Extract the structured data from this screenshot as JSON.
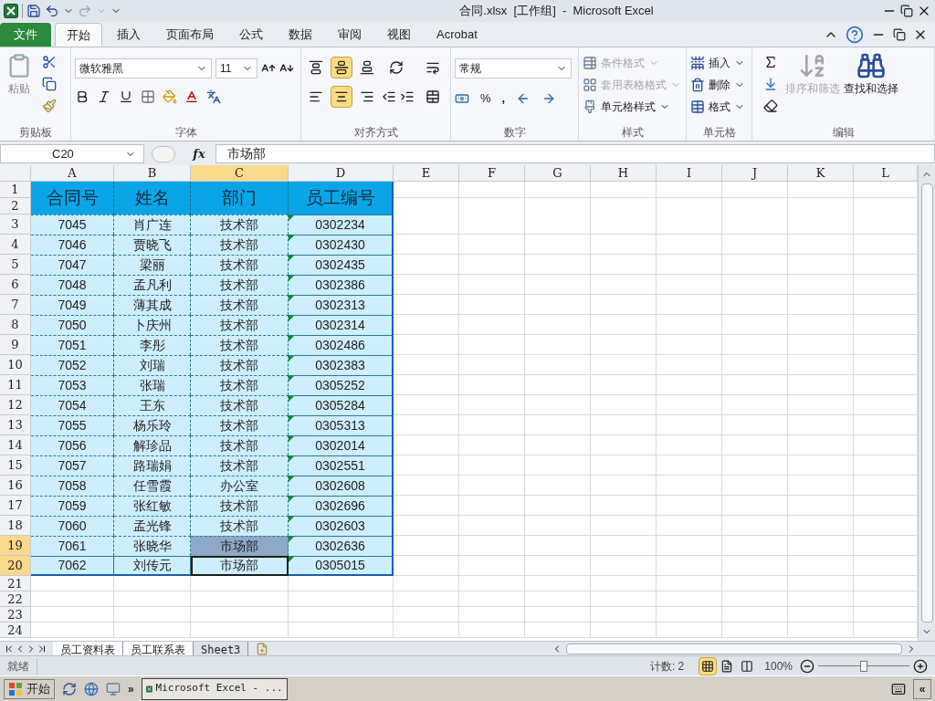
{
  "window": {
    "title": "合同.xlsx  [工作组]  -  Microsoft Excel"
  },
  "menu_tabs": [
    {
      "label": "文件",
      "kind": "file",
      "selected": false
    },
    {
      "label": "开始",
      "kind": "tab",
      "selected": true
    },
    {
      "label": "插入",
      "kind": "tab",
      "selected": false
    },
    {
      "label": "页面布局",
      "kind": "tab",
      "selected": false
    },
    {
      "label": "公式",
      "kind": "tab",
      "selected": false
    },
    {
      "label": "数据",
      "kind": "tab",
      "selected": false
    },
    {
      "label": "审阅",
      "kind": "tab",
      "selected": false
    },
    {
      "label": "视图",
      "kind": "tab",
      "selected": false
    },
    {
      "label": "Acrobat",
      "kind": "tab",
      "selected": false
    }
  ],
  "ribbon": {
    "clipboard": {
      "paste": "粘贴",
      "label": "剪贴板"
    },
    "font": {
      "font_name": "微软雅黑",
      "font_size": "11",
      "label": "字体"
    },
    "alignment": {
      "label": "对齐方式",
      "top_selected": false,
      "middle_selected": true,
      "bottom_selected": false,
      "left_selected": false,
      "center_selected": true,
      "right_selected": false
    },
    "number": {
      "format": "常规",
      "percent": "%",
      "comma": ",",
      "label": "数字"
    },
    "styles": {
      "items": [
        {
          "label": "条件格式",
          "disabled": true
        },
        {
          "label": "套用表格格式",
          "disabled": true
        },
        {
          "label": "单元格样式",
          "disabled": false
        }
      ],
      "label": "样式"
    },
    "cells": {
      "items": [
        {
          "label": "插入"
        },
        {
          "label": "删除"
        },
        {
          "label": "格式"
        }
      ],
      "label": "单元格"
    },
    "editing": {
      "sort": {
        "label": "排序和筛选",
        "disabled": true
      },
      "find": {
        "label": "查找和选择",
        "disabled": false
      },
      "label": "编辑"
    }
  },
  "formula_bar": {
    "name_box": "C20",
    "function_label": "fx",
    "value": "市场部"
  },
  "sheet": {
    "columns": [
      {
        "label": "A",
        "selected": false
      },
      {
        "label": "B",
        "selected": false
      },
      {
        "label": "C",
        "selected": true
      },
      {
        "label": "D",
        "selected": false
      },
      {
        "label": "E",
        "selected": false
      },
      {
        "label": "F",
        "selected": false
      },
      {
        "label": "G",
        "selected": false
      },
      {
        "label": "H",
        "selected": false
      },
      {
        "label": "I",
        "selected": false
      },
      {
        "label": "J",
        "selected": false
      },
      {
        "label": "K",
        "selected": false
      },
      {
        "label": "L",
        "selected": false
      }
    ],
    "header": {
      "row_numbers": [
        "1",
        "2"
      ],
      "cells": [
        "合同号",
        "姓名",
        "部门",
        "员工编号"
      ]
    },
    "rows": [
      {
        "number": "3",
        "selected": false,
        "active": false,
        "cells": [
          "7045",
          "肖广连",
          "技术部",
          "0302234"
        ]
      },
      {
        "number": "4",
        "selected": false,
        "active": false,
        "cells": [
          "7046",
          "贾晓飞",
          "技术部",
          "0302430"
        ]
      },
      {
        "number": "5",
        "selected": false,
        "active": false,
        "cells": [
          "7047",
          "梁丽",
          "技术部",
          "0302435"
        ]
      },
      {
        "number": "6",
        "selected": false,
        "active": false,
        "cells": [
          "7048",
          "孟凡利",
          "技术部",
          "0302386"
        ]
      },
      {
        "number": "7",
        "selected": false,
        "active": false,
        "cells": [
          "7049",
          "薄其成",
          "技术部",
          "0302313"
        ]
      },
      {
        "number": "8",
        "selected": false,
        "active": false,
        "cells": [
          "7050",
          "卜庆州",
          "技术部",
          "0302314"
        ]
      },
      {
        "number": "9",
        "selected": false,
        "active": false,
        "cells": [
          "7051",
          "李彤",
          "技术部",
          "0302486"
        ]
      },
      {
        "number": "10",
        "selected": false,
        "active": false,
        "cells": [
          "7052",
          "刘瑞",
          "技术部",
          "0302383"
        ]
      },
      {
        "number": "11",
        "selected": false,
        "active": false,
        "cells": [
          "7053",
          "张瑞",
          "技术部",
          "0305252"
        ]
      },
      {
        "number": "12",
        "selected": false,
        "active": false,
        "cells": [
          "7054",
          "王东",
          "技术部",
          "0305284"
        ]
      },
      {
        "number": "13",
        "selected": false,
        "active": false,
        "cells": [
          "7055",
          "杨乐玲",
          "技术部",
          "0305313"
        ]
      },
      {
        "number": "14",
        "selected": false,
        "active": false,
        "cells": [
          "7056",
          "解珍品",
          "技术部",
          "0302014"
        ]
      },
      {
        "number": "15",
        "selected": false,
        "active": false,
        "cells": [
          "7057",
          "路瑞娟",
          "技术部",
          "0302551"
        ]
      },
      {
        "number": "16",
        "selected": false,
        "active": false,
        "cells": [
          "7058",
          "任雪霞",
          "办公室",
          "0302608"
        ]
      },
      {
        "number": "17",
        "selected": false,
        "active": false,
        "cells": [
          "7059",
          "张红敏",
          "技术部",
          "0302696"
        ]
      },
      {
        "number": "18",
        "selected": false,
        "active": false,
        "cells": [
          "7060",
          "孟光锋",
          "技术部",
          "0302603"
        ]
      },
      {
        "number": "19",
        "selected": true,
        "active": false,
        "cells": [
          "7061",
          "张晓华",
          "市场部",
          "0302636"
        ]
      },
      {
        "number": "20",
        "selected": true,
        "active": true,
        "cells": [
          "7062",
          "刘传元",
          "市场部",
          "0305015"
        ]
      }
    ],
    "empty_rows": [
      "21",
      "22",
      "23",
      "24"
    ]
  },
  "sheet_tabs": [
    {
      "label": "员工资料表",
      "selected": true
    },
    {
      "label": "员工联系表",
      "selected": true
    },
    {
      "label": "Sheet3",
      "selected": false
    }
  ],
  "status_bar": {
    "ready": "就绪",
    "count": "计数: 2",
    "view_normal_selected": true,
    "zoom": "100%",
    "zoom_slider": {
      "level": 0.5
    }
  },
  "taskbar": {
    "start": "开始",
    "more": "»",
    "task": "Microsoft Excel - ...",
    "collapse": "«"
  }
}
